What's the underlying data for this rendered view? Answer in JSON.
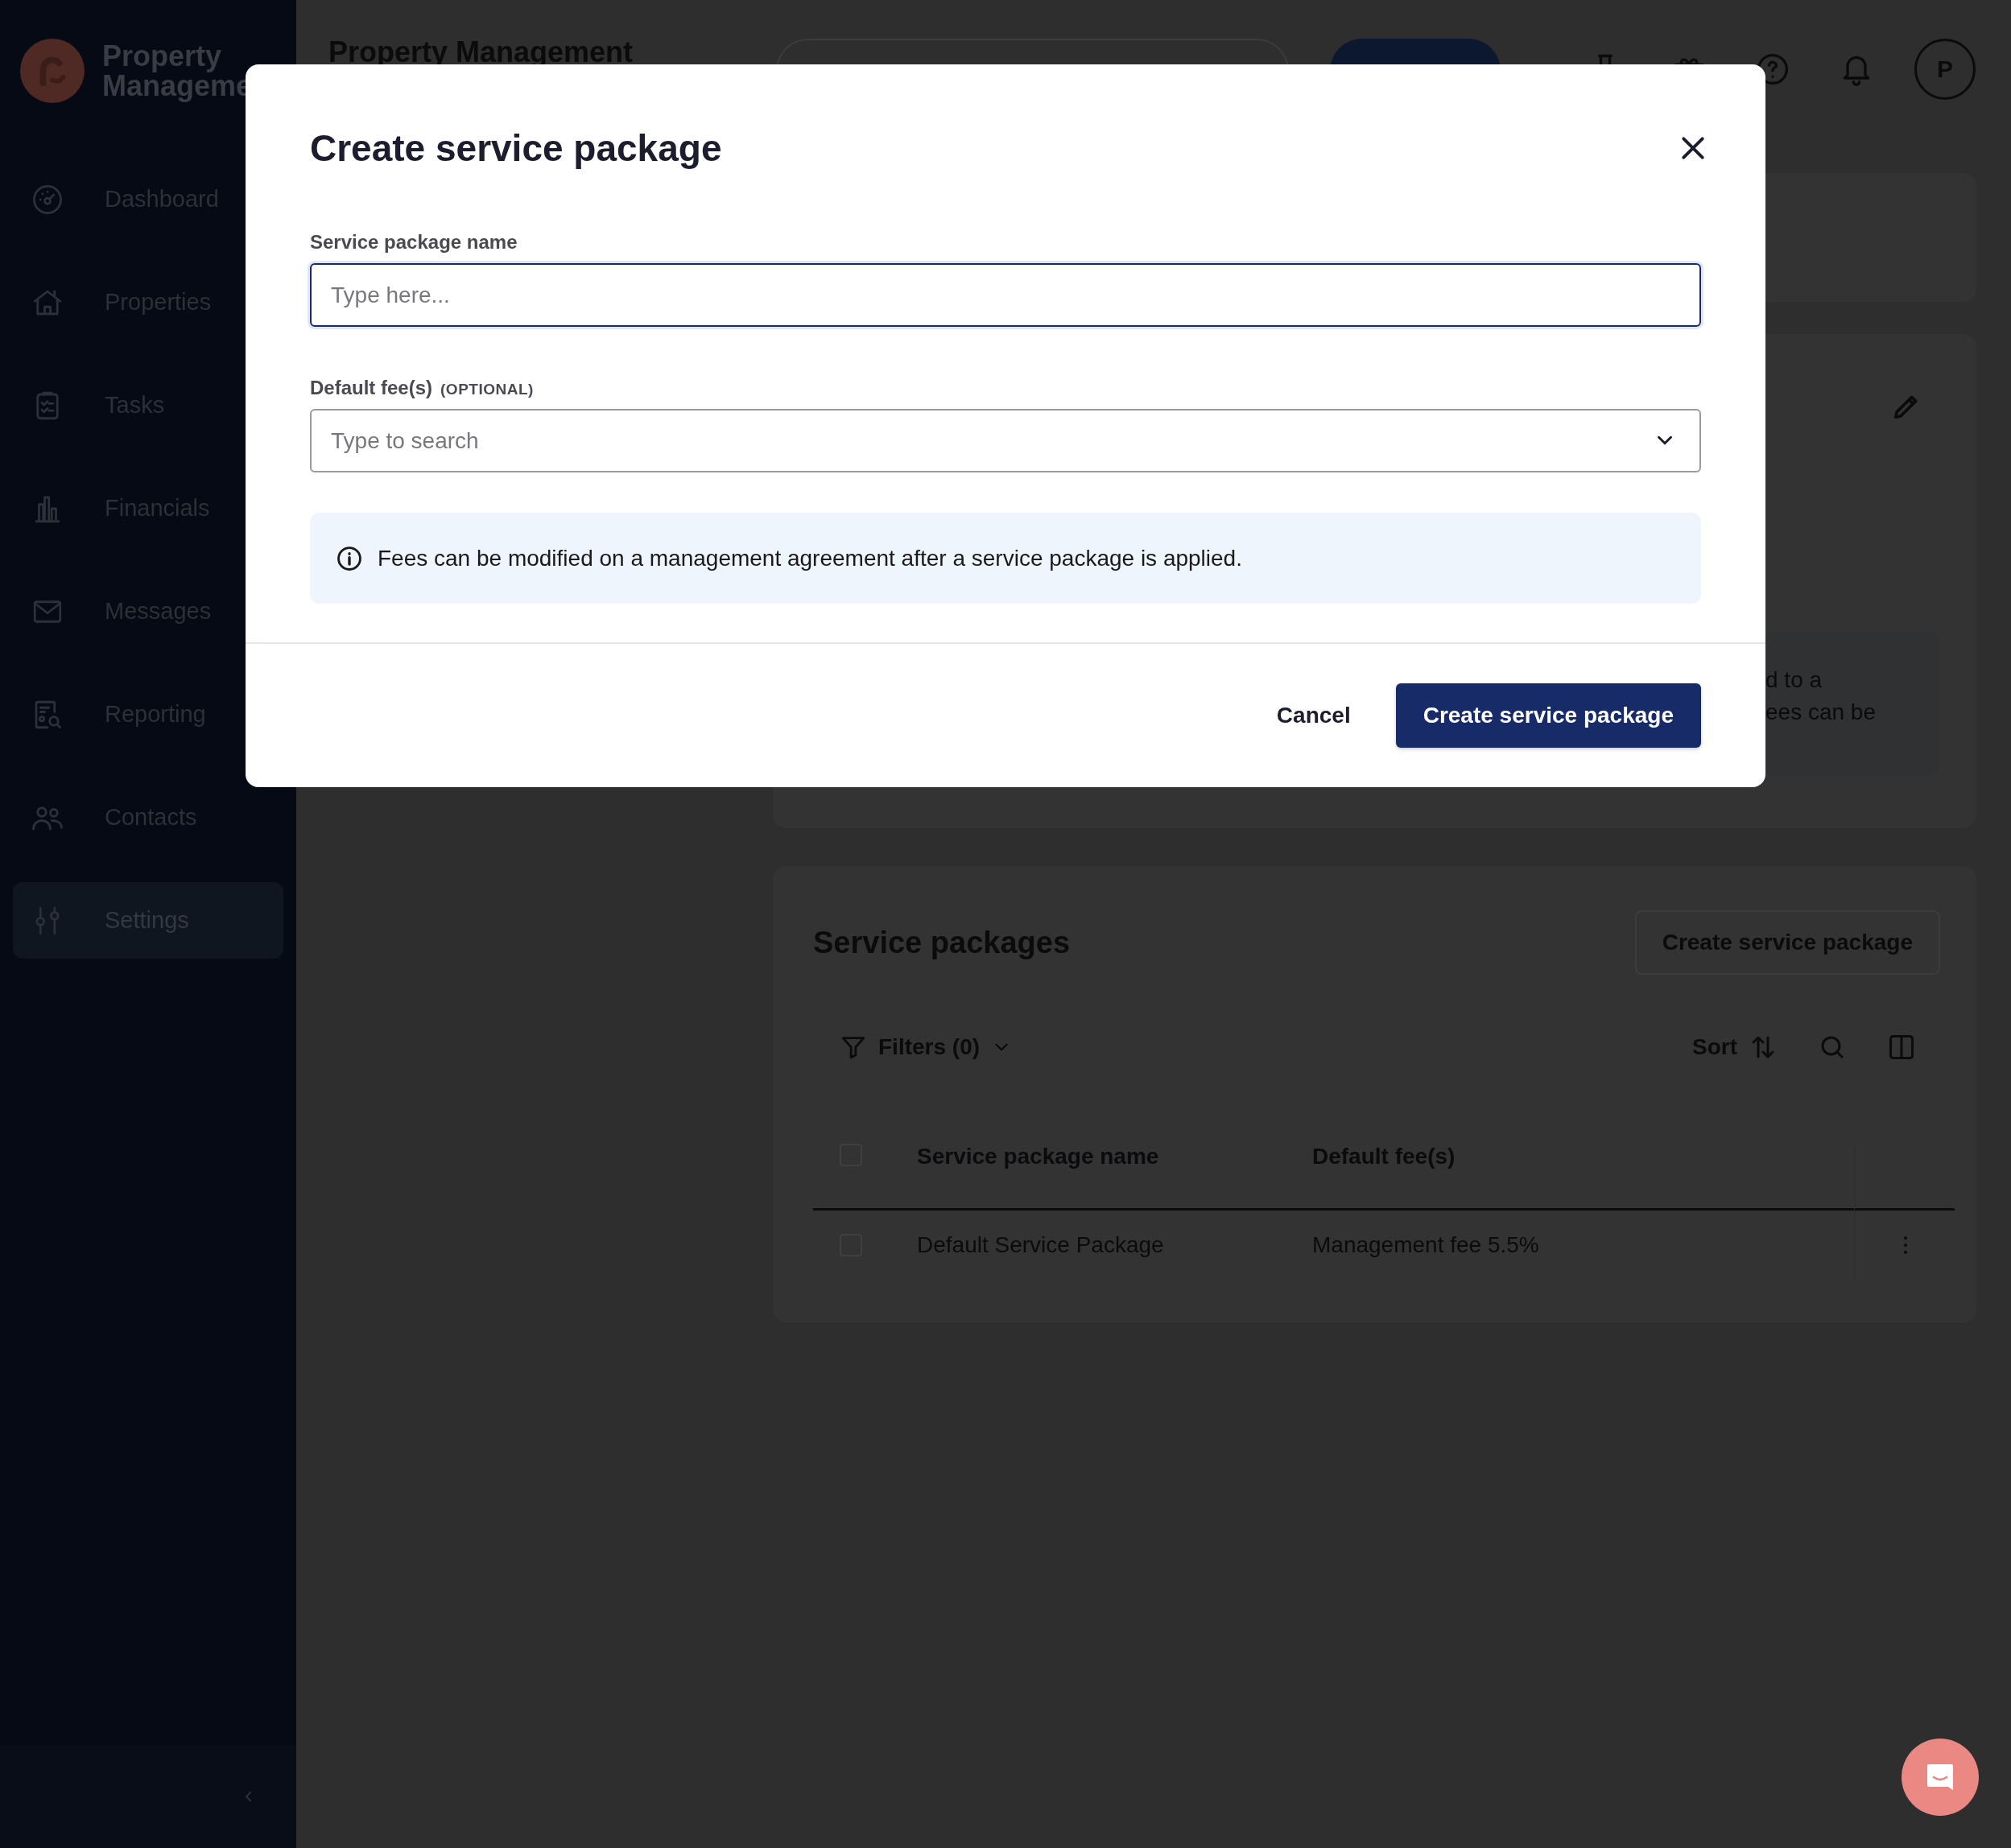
{
  "sidebar": {
    "logo_lines": [
      "Property",
      "Manageme"
    ],
    "items": [
      {
        "label": "Dashboard",
        "selected": false
      },
      {
        "label": "Properties",
        "selected": false
      },
      {
        "label": "Tasks",
        "selected": false
      },
      {
        "label": "Financials",
        "selected": false
      },
      {
        "label": "Messages",
        "selected": false
      },
      {
        "label": "Reporting",
        "selected": false
      },
      {
        "label": "Contacts",
        "selected": false
      },
      {
        "label": "Settings",
        "selected": true
      }
    ]
  },
  "header": {
    "title": "Property Management",
    "avatar": "P"
  },
  "content": {
    "card_text_fragments": [
      "d to a",
      "ees can be"
    ],
    "service_packages": {
      "title": "Service packages",
      "create_button": "Create service package",
      "filters": "Filters (0)",
      "sort": "Sort",
      "columns": [
        "Service package name",
        "Default fee(s)"
      ],
      "all_checked": false,
      "rows": [
        {
          "name": "Default Service Package",
          "fees": "Management fee 5.5%",
          "selected": false
        }
      ]
    }
  },
  "modal": {
    "title": "Create service package",
    "fields": [
      {
        "kind": "text",
        "label": "Service package name",
        "placeholder": "Type here...",
        "focused": true
      },
      {
        "kind": "select",
        "label": "Default fee(s)",
        "tag": "(OPTIONAL)",
        "placeholder": "Type to search",
        "focused": false
      }
    ],
    "info": "Fees can be modified on a management agreement after a service package is applied.",
    "cancel": "Cancel",
    "submit": "Create service package"
  }
}
